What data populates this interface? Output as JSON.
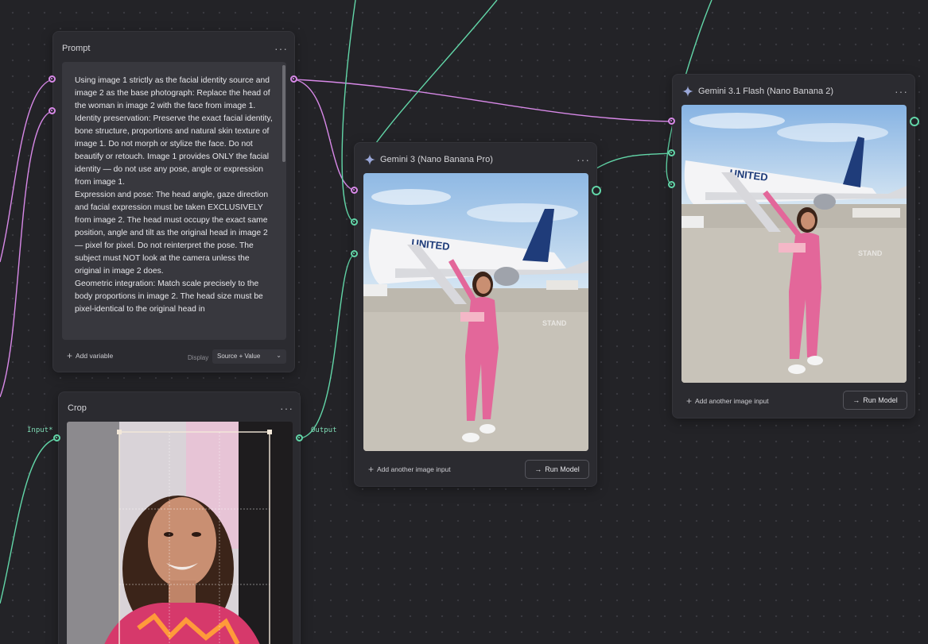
{
  "colors": {
    "canvas": "#232327",
    "node": "#2b2b30",
    "text_wire": "#d889e8",
    "image_wire": "#62d6a8"
  },
  "prompt_node": {
    "title": "Prompt",
    "menu": "···",
    "text": "Using image 1 strictly as the facial identity source and image 2 as the base photograph: Replace the head of the woman in image 2 with the face from image 1.\nIdentity preservation: Preserve the exact facial identity, bone structure, proportions and natural skin texture of image 1. Do not morph or stylize the face. Do not beautify or retouch. Image 1 provides ONLY the facial identity — do not use any pose, angle or expression from image 1.\nExpression and pose: The head angle, gaze direction and facial expression must be taken EXCLUSIVELY from image 2. The head must occupy the exact same position, angle and tilt as the original head in image 2 — pixel for pixel. Do not reinterpret the pose. The subject must NOT look at the camera unless the original in image 2 does.\nGeometric integration: Match scale precisely to the body proportions in image 2. The head size must be pixel-identical to the original head in",
    "add_variable": "Add variable",
    "display_label": "Display",
    "display_value": "Source + Value"
  },
  "crop_node": {
    "title": "Crop",
    "menu": "···",
    "input_label": "Input*",
    "output_label": "Output"
  },
  "gemini3_node": {
    "title": "Gemini 3 (Nano Banana Pro)",
    "menu": "···",
    "add_input": "Add another image input",
    "run": "Run Model",
    "image_icon": "generated-photo-woman-airplane"
  },
  "gemini31_node": {
    "title": "Gemini 3.1 Flash (Nano Banana 2)",
    "menu": "···",
    "add_input": "Add another image input",
    "run": "Run Model",
    "image_icon": "generated-photo-woman-airplane"
  },
  "airplane_text": "UNITED",
  "stand_text": "STAND"
}
